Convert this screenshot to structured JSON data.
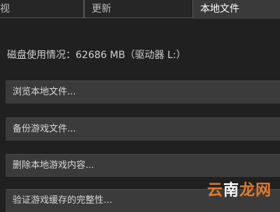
{
  "tabs": [
    {
      "label": "视",
      "active": false
    },
    {
      "label": "更新",
      "active": false
    },
    {
      "label": "本地文件",
      "active": true
    }
  ],
  "disk_usage": "磁盘使用情况：62686 MB（驱动器 L:）",
  "buttons": [
    {
      "label": "浏览本地文件..."
    },
    {
      "label": "备份游戏文件..."
    },
    {
      "label": "删除本地游戏内容..."
    },
    {
      "label": "验证游戏缓存的完整性..."
    }
  ],
  "watermark": {
    "part1": "云",
    "part2": "南",
    "part3": "龙网"
  },
  "colors": {
    "background": "#202020",
    "button": "#3b3b3b",
    "active_tab": "#3a3a3a",
    "watermark_accent": "#e07a2c"
  }
}
